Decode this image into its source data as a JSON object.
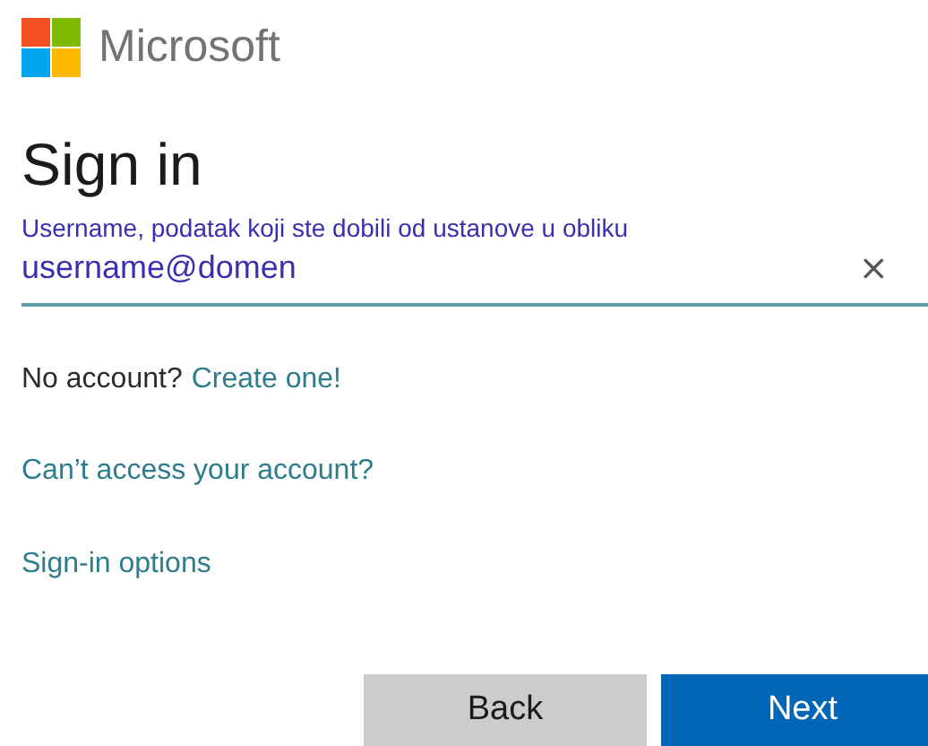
{
  "brand": {
    "name": "Microsoft"
  },
  "heading": "Sign in",
  "username_field": {
    "hint": "Username, podatak koji ste dobili od ustanove u obliku",
    "value": "username@domen",
    "clear": "×"
  },
  "no_account": {
    "text": "No account?",
    "link": "Create one!"
  },
  "links": [
    "Can’t access your account?",
    "Sign-in options"
  ],
  "buttons": [
    {
      "label": "Back",
      "kind": "secondary"
    },
    {
      "label": "Next",
      "kind": "primary"
    }
  ]
}
